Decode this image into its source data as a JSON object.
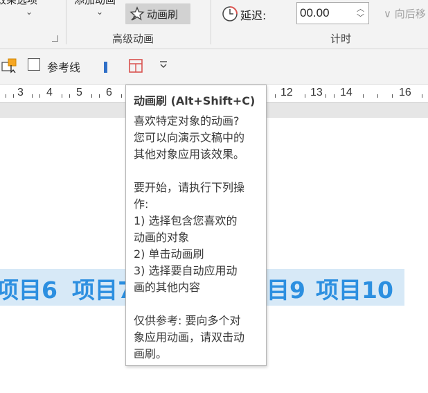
{
  "ribbon": {
    "clipped_top_left": "效果选项",
    "clipped_top_mid": "添加动画",
    "animation_painter_label": "动画刷",
    "advanced_group_label": "高级动画",
    "delay_label": "延迟:",
    "delay_value": "00.00",
    "timing_group_label": "计时",
    "move_back_label": "向后移"
  },
  "toolbar2": {
    "guides_label": "参考线"
  },
  "ruler": {
    "numbers": [
      "3",
      "4",
      "5",
      "6",
      "12",
      "13",
      "14",
      "16"
    ]
  },
  "slide": {
    "items": [
      "项目6",
      "项目7",
      "目9",
      "项目10"
    ]
  },
  "tooltip": {
    "title": "动画刷 (Alt+Shift+C)",
    "body": "喜欢特定对象的动画?\n您可以向演示文稿中的\n其他对象应用该效果。\n\n要开始，请执行下列操\n作:\n1) 选择包含您喜欢的\n动画的对象\n2) 单击动画刷\n3) 选择要自动应用动\n画的其他内容\n\n仅供参考: 要向多个对\n象应用动画，请双击动\n画刷。"
  },
  "colors": {
    "accent": "#2c8fe0",
    "banner": "#d7e9f7",
    "ribbon": "#f3f3f3"
  }
}
